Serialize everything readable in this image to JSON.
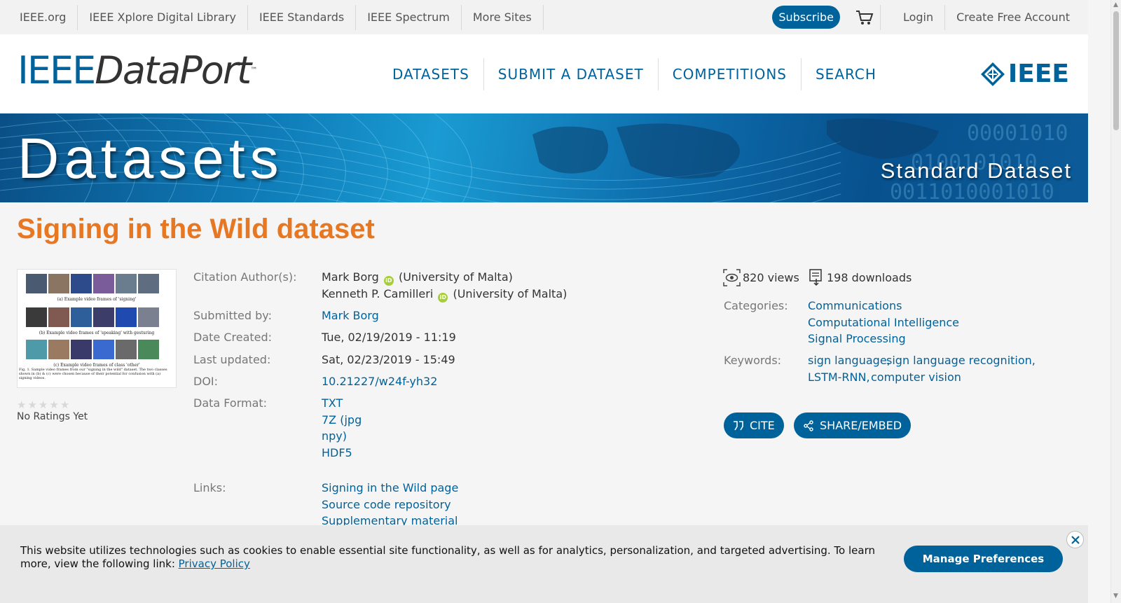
{
  "topbar": {
    "sites": [
      "IEEE.org",
      "IEEE Xplore Digital Library",
      "IEEE Standards",
      "IEEE Spectrum",
      "More Sites"
    ],
    "subscribe": "Subscribe",
    "login": "Login",
    "create_account": "Create Free Account"
  },
  "header": {
    "logo_ieee": "IEEE",
    "logo_dataport": "DataPort",
    "logo_tm": "™",
    "nav": [
      "DATASETS",
      "SUBMIT A DATASET",
      "COMPETITIONS",
      "SEARCH"
    ],
    "ieee_mark": "IEEE"
  },
  "banner": {
    "title": "Datasets",
    "subtitle": "Standard Dataset"
  },
  "dataset": {
    "title": "Signing in the Wild dataset",
    "rating_text": "No Ratings Yet",
    "labels": {
      "authors": "Citation Author(s):",
      "submitted_by": "Submitted by:",
      "date_created": "Date Created:",
      "last_updated": "Last updated:",
      "doi": "DOI:",
      "data_format": "Data Format:",
      "links": "Links:"
    },
    "authors": [
      {
        "name": "Mark Borg",
        "affiliation": "(University of Malta)"
      },
      {
        "name": "Kenneth P. Camilleri",
        "affiliation": "(University of Malta)"
      }
    ],
    "submitted_by": "Mark Borg",
    "date_created": "Tue, 02/19/2019 - 11:19",
    "last_updated": "Sat, 02/23/2019 - 15:49",
    "doi": "10.21227/w24f-yh32",
    "data_format": [
      "TXT",
      "7Z (jpg",
      "npy)",
      "HDF5"
    ],
    "links": [
      "Signing in the Wild page",
      "Source code repository",
      "Supplementary material"
    ]
  },
  "sidebar": {
    "views": "820 views",
    "downloads": "198 downloads",
    "categories_label": "Categories:",
    "categories": [
      "Communications",
      "Computational Intelligence",
      "Signal Processing"
    ],
    "keywords_label": "Keywords:",
    "keywords": [
      "sign language,",
      "sign language recognition,",
      "LSTM-RNN,",
      "computer vision"
    ],
    "cite": "CITE",
    "share": "SHARE/EMBED"
  },
  "thumbnail": {
    "caption_a": "(a) Example video frames of 'signing'",
    "caption_b": "(b) Example video frames of 'speaking' with gesturing",
    "caption_c": "(c) Example video frames of class 'other'",
    "fig_caption": "Fig. 1. Sample video frames from our \"signing in the wild\" dataset. The two classes shown in (b) & (c) were chosen because of their potential for confusion with (a) signing videos."
  },
  "cookie": {
    "message": "This website utilizes technologies such as cookies to enable essential site functionality, as well as for analytics, personalization, and targeted advertising. To learn more, view the following link: ",
    "privacy_link": "Privacy Policy",
    "manage": "Manage Preferences"
  },
  "colors": {
    "brand": "#00629b",
    "title_orange": "#e87722"
  }
}
